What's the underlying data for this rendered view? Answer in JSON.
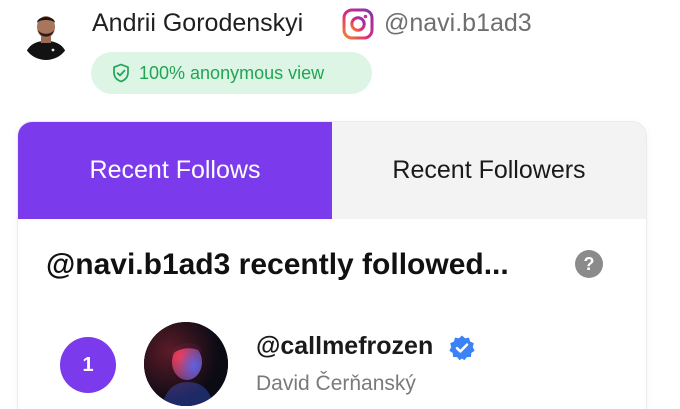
{
  "profile": {
    "name": "Andrii Gorodenskyi",
    "handle": "@navi.b1ad3",
    "platform_icon": "instagram-icon",
    "badge": {
      "icon": "shield-check-icon",
      "text": "100% anonymous view"
    }
  },
  "tabs": [
    {
      "label": "Recent Follows",
      "active": true
    },
    {
      "label": "Recent Followers",
      "active": false
    }
  ],
  "section": {
    "title": "@navi.b1ad3 recently followed...",
    "help_icon": "question-mark-icon",
    "help_glyph": "?"
  },
  "follows": [
    {
      "rank": "1",
      "username": "@callmefrozen",
      "full_name": "David Čerňanský",
      "verified": true
    }
  ],
  "colors": {
    "accent": "#7c3aed",
    "badge_bg": "#dcf5e4",
    "badge_text": "#23a455",
    "verified": "#3b82f6"
  }
}
